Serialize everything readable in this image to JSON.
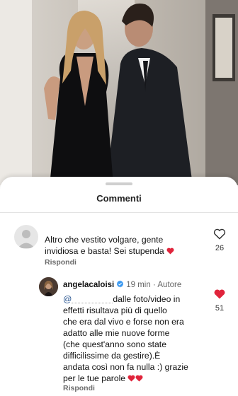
{
  "sheet": {
    "title": "Commenti"
  },
  "comments": [
    {
      "text": "Altro che vestito volgare, gente\ninvidiosa e basta! Sei stupenda",
      "reply_label": "Rispondi",
      "likes": "26",
      "liked": false
    },
    {
      "username": "angelacaloisi",
      "time": "19 min",
      "separator": "·",
      "role": "Autore",
      "mention": "@",
      "text": "dalle foto/video in\neffetti risultava più di quello\nche era dal vivo e forse non era\nadatto alle mie nuove forme\n(che quest'anno sono state\ndifficilissime da gestire).È\nandata così non fa nulla :) grazie\nper le tue parole",
      "reply_label": "Rispondi",
      "likes": "51",
      "liked": true
    }
  ],
  "colors": {
    "heart_red": "#e0243b",
    "verified_blue": "#3897f0"
  }
}
